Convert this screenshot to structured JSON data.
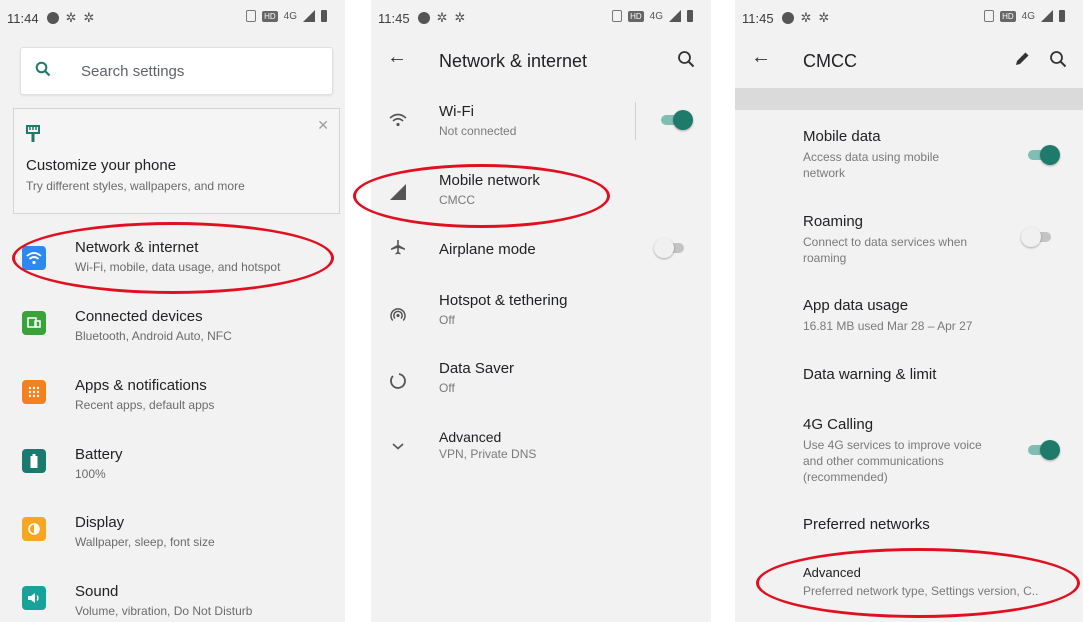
{
  "panel1": {
    "status_time": "11:44",
    "search_placeholder": "Search settings",
    "customize": {
      "title": "Customize your phone",
      "subtitle": "Try different styles, wallpapers, and more"
    },
    "items": [
      {
        "title": "Network & internet",
        "subtitle": "Wi-Fi, mobile, data usage, and hotspot",
        "icon": "wifi-icon",
        "color": "#2d88f0"
      },
      {
        "title": "Connected devices",
        "subtitle": "Bluetooth, Android Auto, NFC",
        "icon": "devices-icon",
        "color": "#3aa23a"
      },
      {
        "title": "Apps & notifications",
        "subtitle": "Recent apps, default apps",
        "icon": "apps-icon",
        "color": "#f4811f"
      },
      {
        "title": "Battery",
        "subtitle": "100%",
        "icon": "battery-icon",
        "color": "#1b7a6e"
      },
      {
        "title": "Display",
        "subtitle": "Wallpaper, sleep, font size",
        "icon": "display-icon",
        "color": "#f5a623"
      },
      {
        "title": "Sound",
        "subtitle": "Volume, vibration, Do Not Disturb",
        "icon": "sound-icon",
        "color": "#17a39a"
      }
    ]
  },
  "panel2": {
    "status_time": "11:45",
    "title": "Network & internet",
    "items": [
      {
        "title": "Wi-Fi",
        "subtitle": "Not connected",
        "icon": "wifi-icon"
      },
      {
        "title": "Mobile network",
        "subtitle": "CMCC",
        "icon": "signal-icon"
      },
      {
        "title": "Airplane mode",
        "subtitle": "",
        "icon": "airplane-icon"
      },
      {
        "title": "Hotspot & tethering",
        "subtitle": "Off",
        "icon": "hotspot-icon"
      },
      {
        "title": "Data Saver",
        "subtitle": "Off",
        "icon": "data-saver-icon"
      },
      {
        "title": "Advanced",
        "subtitle": "VPN, Private DNS",
        "icon": "chevron-down-icon"
      }
    ],
    "wifi_toggle": true,
    "airplane_toggle": false
  },
  "panel3": {
    "status_time": "11:45",
    "title": "CMCC",
    "items": [
      {
        "title": "Mobile data",
        "subtitle": "Access data using mobile network"
      },
      {
        "title": "Roaming",
        "subtitle": "Connect to data services when roaming"
      },
      {
        "title": "App data usage",
        "subtitle": "16.81 MB used Mar 28 – Apr 27"
      },
      {
        "title": "Data warning & limit",
        "subtitle": ""
      },
      {
        "title": "4G Calling",
        "subtitle": "Use 4G services to improve voice and other communications (recommended)"
      },
      {
        "title": "Preferred networks",
        "subtitle": ""
      },
      {
        "title": "Advanced",
        "subtitle": "Preferred network type, Settings version, C.."
      }
    ],
    "mobile_data_toggle": true,
    "roaming_toggle": false,
    "calling_toggle": true
  },
  "colors": {
    "accent": "#1e7b6b",
    "highlight": "#e01020"
  }
}
